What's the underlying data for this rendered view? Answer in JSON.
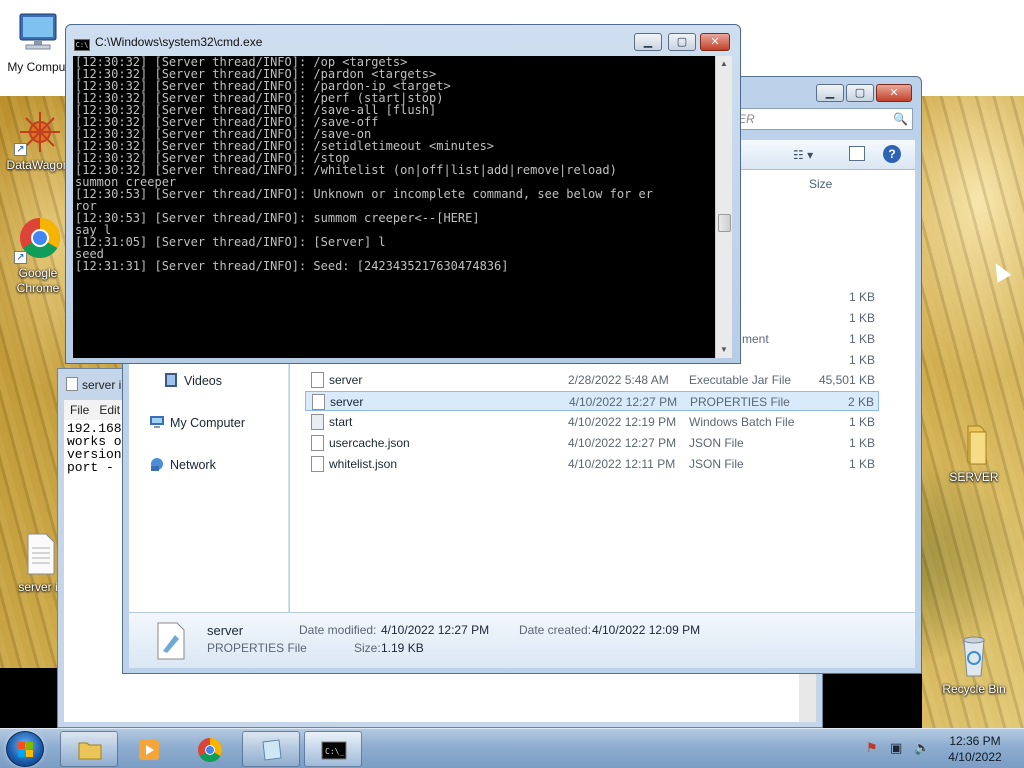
{
  "desktop": {
    "icons": [
      {
        "label": "My Comput",
        "glyph": "computer-icon"
      },
      {
        "label": "DataWagon",
        "glyph": "datawagon-icon"
      },
      {
        "label": "Google Chrome",
        "glyph": "chrome-icon"
      },
      {
        "label": "server i",
        "glyph": "text-file-icon"
      },
      {
        "label": "SERVER",
        "glyph": "folder-icon"
      },
      {
        "label": "Recycle Bin",
        "glyph": "recycle-bin-icon"
      }
    ]
  },
  "notepad": {
    "title": "server i",
    "menu": [
      "File",
      "Edit"
    ],
    "lines": [
      "192.168",
      "works o",
      "version",
      "port -"
    ]
  },
  "explorer": {
    "search_placeholder": "ER",
    "columns": {
      "size": "Size"
    },
    "nav": [
      {
        "label": "Videos",
        "icon": "videos-icon"
      },
      {
        "label": "My Computer",
        "icon": "computer-icon"
      },
      {
        "label": "Network",
        "icon": "network-icon"
      }
    ],
    "partial_rows": [
      {
        "type": "",
        "size": "1 KB"
      },
      {
        "type": "",
        "size": "1 KB"
      },
      {
        "type": "ment",
        "size": "1 KB"
      },
      {
        "type": "",
        "size": "1 KB"
      }
    ],
    "files": [
      {
        "name": "server",
        "date": "2/28/2022 5:48 AM",
        "type": "Executable Jar File",
        "size": "45,501 KB",
        "selected": false
      },
      {
        "name": "server",
        "date": "4/10/2022 12:27 PM",
        "type": "PROPERTIES File",
        "size": "2 KB",
        "selected": true
      },
      {
        "name": "start",
        "date": "4/10/2022 12:19 PM",
        "type": "Windows Batch File",
        "size": "1 KB",
        "selected": false
      },
      {
        "name": "usercache.json",
        "date": "4/10/2022 12:27 PM",
        "type": "JSON File",
        "size": "1 KB",
        "selected": false
      },
      {
        "name": "whitelist.json",
        "date": "4/10/2022 12:11 PM",
        "type": "JSON File",
        "size": "1 KB",
        "selected": false
      }
    ],
    "details": {
      "name": "server",
      "type": "PROPERTIES File",
      "modified_label": "Date modified:",
      "modified_value": "4/10/2022 12:27 PM",
      "created_label": "Date created:",
      "created_value": "4/10/2022 12:09 PM",
      "size_label": "Size:",
      "size_value": "1.19 KB"
    }
  },
  "cmd": {
    "title": "C:\\Windows\\system32\\cmd.exe",
    "lines": [
      "[12:30:32] [Server thread/INFO]: /op <targets>",
      "[12:30:32] [Server thread/INFO]: /pardon <targets>",
      "[12:30:32] [Server thread/INFO]: /pardon-ip <target>",
      "[12:30:32] [Server thread/INFO]: /perf (start|stop)",
      "[12:30:32] [Server thread/INFO]: /save-all [flush]",
      "[12:30:32] [Server thread/INFO]: /save-off",
      "[12:30:32] [Server thread/INFO]: /save-on",
      "[12:30:32] [Server thread/INFO]: /setidletimeout <minutes>",
      "[12:30:32] [Server thread/INFO]: /stop",
      "[12:30:32] [Server thread/INFO]: /whitelist (on|off|list|add|remove|reload)",
      "summon creeper",
      "[12:30:53] [Server thread/INFO]: Unknown or incomplete command, see below for er",
      "ror",
      "[12:30:53] [Server thread/INFO]: summom creeper<--[HERE]",
      "say l",
      "[12:31:05] [Server thread/INFO]: [Server] l",
      "seed",
      "[12:31:31] [Server thread/INFO]: Seed: [2423435217630474836]"
    ]
  },
  "taskbar": {
    "buttons": [
      {
        "name": "explorer",
        "icon": "folder-icon"
      },
      {
        "name": "media-player",
        "icon": "media-player-icon"
      },
      {
        "name": "chrome",
        "icon": "chrome-icon"
      },
      {
        "name": "notepad",
        "icon": "notepad-icon"
      },
      {
        "name": "cmd",
        "icon": "cmd-icon"
      }
    ],
    "clock_time": "12:36 PM",
    "clock_date": "4/10/2022"
  },
  "colors": {
    "console_bg": "#000000",
    "console_text": "#c0c0c0",
    "selection": "#d9ebfb",
    "close_button": "#c2412a"
  }
}
